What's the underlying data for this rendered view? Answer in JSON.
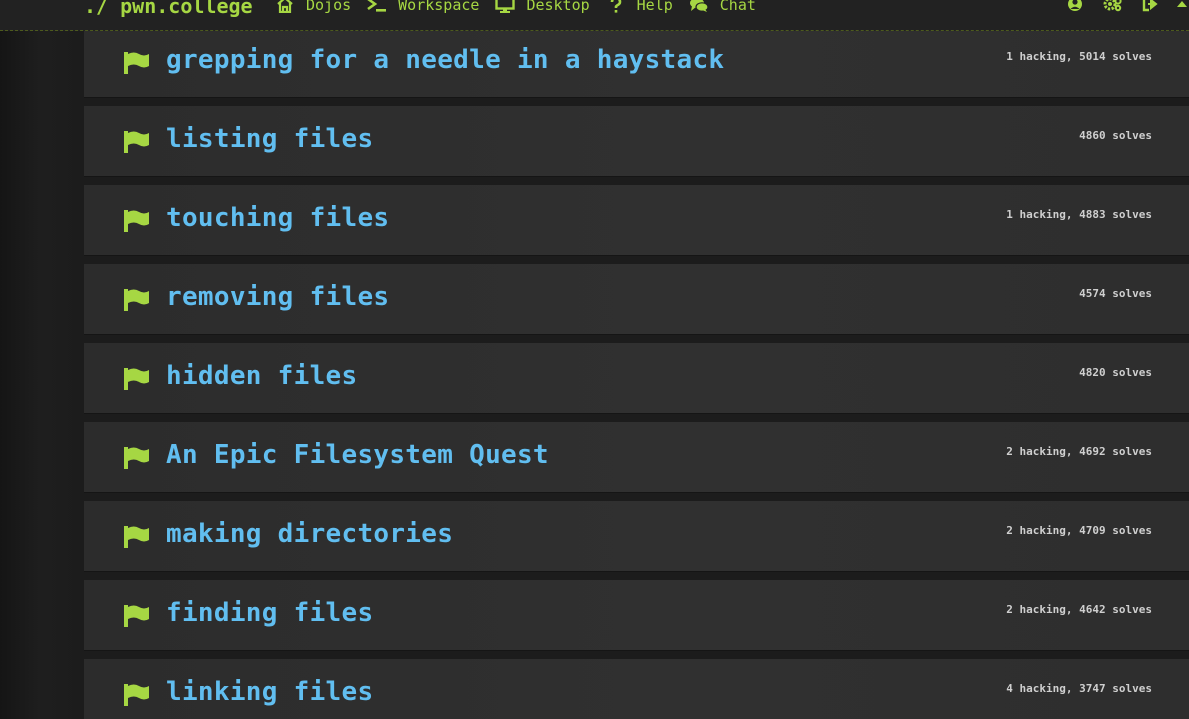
{
  "nav": {
    "brand": "./ pwn.college",
    "links": [
      {
        "label": "Dojos",
        "icon": "home-icon"
      },
      {
        "label": "Workspace",
        "icon": "terminal-icon"
      },
      {
        "label": "Desktop",
        "icon": "desktop-icon"
      },
      {
        "label": "Help",
        "icon": "question-icon"
      },
      {
        "label": "Chat",
        "icon": "chat-icon"
      }
    ],
    "right_icons": [
      "user-icon",
      "gear-icon",
      "logout-icon",
      "caret-up-icon"
    ]
  },
  "colors": {
    "accent_green": "#a6d743",
    "title_blue": "#61bef0",
    "stats_text": "#cfcfcf"
  },
  "challenges": [
    {
      "title": "grepping for a needle in a haystack",
      "stats": "1 hacking, 5014 solves",
      "icon": "flag-icon"
    },
    {
      "title": "listing files",
      "stats": "4860 solves",
      "icon": "flag-icon"
    },
    {
      "title": "touching files",
      "stats": "1 hacking, 4883 solves",
      "icon": "flag-icon"
    },
    {
      "title": "removing files",
      "stats": "4574 solves",
      "icon": "flag-icon"
    },
    {
      "title": "hidden files",
      "stats": "4820 solves",
      "icon": "flag-icon"
    },
    {
      "title": "An Epic Filesystem Quest",
      "stats": "2 hacking, 4692 solves",
      "icon": "flag-icon"
    },
    {
      "title": "making directories",
      "stats": "2 hacking, 4709 solves",
      "icon": "flag-icon"
    },
    {
      "title": "finding files",
      "stats": "2 hacking, 4642 solves",
      "icon": "flag-icon"
    },
    {
      "title": "linking files",
      "stats": "4 hacking, 3747 solves",
      "icon": "flag-icon"
    }
  ]
}
